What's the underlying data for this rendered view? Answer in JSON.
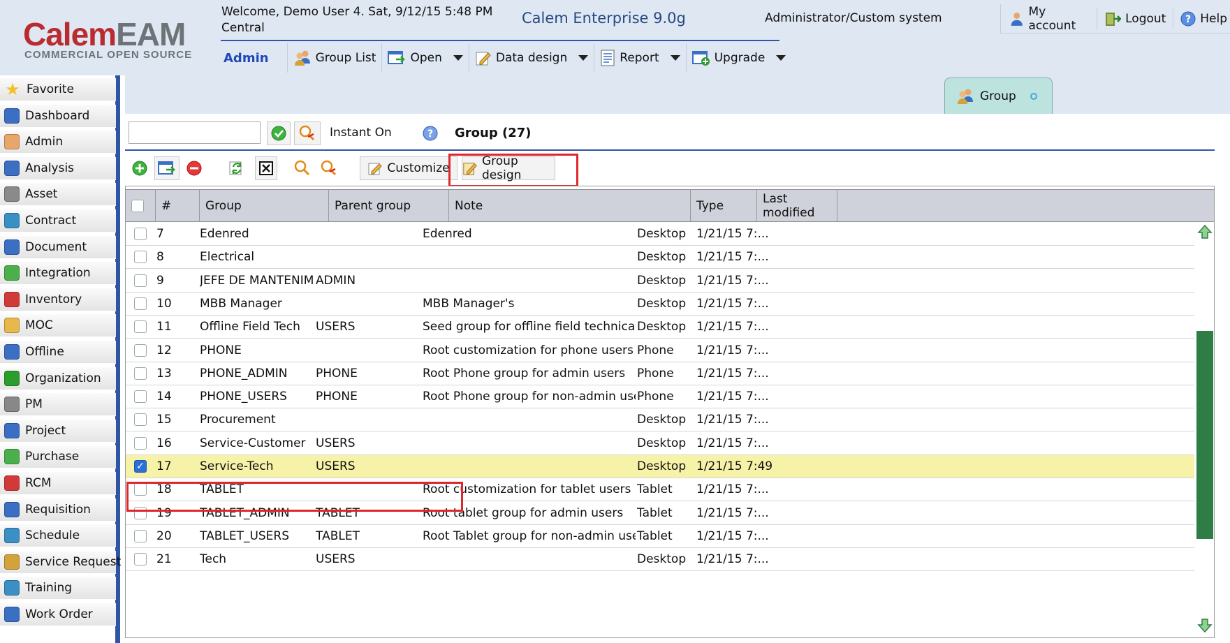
{
  "header": {
    "logo_main_1": "Calem",
    "logo_main_2": "EAM",
    "logo_sub": "COMMERCIAL OPEN SOURCE",
    "welcome_line1": "Welcome, Demo User 4. Sat, 9/12/15 5:48 PM",
    "welcome_line2": "Central",
    "product": "Calem Enterprise 9.0g",
    "admin_system": "Administrator/Custom system",
    "my_account": "My account",
    "logout": "Logout",
    "help": "Help"
  },
  "toolbar": {
    "section": "Admin",
    "group_list": "Group List",
    "open": "Open",
    "data_design": "Data design",
    "report": "Report",
    "upgrade": "Upgrade"
  },
  "sidebar": {
    "items": [
      {
        "label": "Favorite",
        "icon": "star-icon"
      },
      {
        "label": "Dashboard",
        "icon": "dashboard-icon"
      },
      {
        "label": "Admin",
        "icon": "admin-icon"
      },
      {
        "label": "Analysis",
        "icon": "analysis-icon"
      },
      {
        "label": "Asset",
        "icon": "asset-icon"
      },
      {
        "label": "Contract",
        "icon": "contract-icon"
      },
      {
        "label": "Document",
        "icon": "document-icon"
      },
      {
        "label": "Integration",
        "icon": "integration-icon"
      },
      {
        "label": "Inventory",
        "icon": "inventory-icon"
      },
      {
        "label": "MOC",
        "icon": "moc-icon"
      },
      {
        "label": "Offline",
        "icon": "offline-icon"
      },
      {
        "label": "Organization",
        "icon": "organization-icon"
      },
      {
        "label": "PM",
        "icon": "pm-icon"
      },
      {
        "label": "Project",
        "icon": "project-icon"
      },
      {
        "label": "Purchase",
        "icon": "purchase-icon"
      },
      {
        "label": "RCM",
        "icon": "rcm-icon"
      },
      {
        "label": "Requisition",
        "icon": "requisition-icon"
      },
      {
        "label": "Schedule",
        "icon": "schedule-icon"
      },
      {
        "label": "Service Request",
        "icon": "service-request-icon"
      },
      {
        "label": "Training",
        "icon": "training-icon"
      },
      {
        "label": "Work Order",
        "icon": "work-order-icon"
      }
    ]
  },
  "tab": {
    "label": "Group"
  },
  "search": {
    "value": "",
    "instant_on": "Instant On",
    "title": "Group (27)"
  },
  "actions": {
    "customize": "Customize",
    "group_design": "Group design"
  },
  "grid": {
    "columns": [
      "#",
      "Group",
      "Parent group",
      "Note",
      "Type",
      "Last modified"
    ],
    "columns_display": {
      "type_h": "Type",
      "last_h1": "Last",
      "last_h2": "modified"
    },
    "rows": [
      {
        "num": "7",
        "group": "Edenred",
        "parent": "",
        "note": "Edenred",
        "type": "Desktop",
        "modified": "1/21/15 7:...",
        "checked": false
      },
      {
        "num": "8",
        "group": "Electrical",
        "parent": "",
        "note": "",
        "type": "Desktop",
        "modified": "1/21/15 7:...",
        "checked": false
      },
      {
        "num": "9",
        "group": "JEFE DE MANTENIM...",
        "parent": "ADMIN",
        "note": "",
        "type": "Desktop",
        "modified": "1/21/15 7:...",
        "checked": false
      },
      {
        "num": "10",
        "group": "MBB Manager",
        "parent": "",
        "note": "MBB Manager's",
        "type": "Desktop",
        "modified": "1/21/15 7:...",
        "checked": false
      },
      {
        "num": "11",
        "group": "Offline Field Tech",
        "parent": "USERS",
        "note": "Seed group for offline field technicans",
        "type": "Desktop",
        "modified": "1/21/15 7:...",
        "checked": false
      },
      {
        "num": "12",
        "group": "PHONE",
        "parent": "",
        "note": "Root customization for phone users",
        "type": "Phone",
        "modified": "1/21/15 7:...",
        "checked": false
      },
      {
        "num": "13",
        "group": "PHONE_ADMIN",
        "parent": "PHONE",
        "note": "Root Phone group for admin users",
        "type": "Phone",
        "modified": "1/21/15 7:...",
        "checked": false
      },
      {
        "num": "14",
        "group": "PHONE_USERS",
        "parent": "PHONE",
        "note": "Root Phone group for non-admin users",
        "type": "Phone",
        "modified": "1/21/15 7:...",
        "checked": false
      },
      {
        "num": "15",
        "group": "Procurement",
        "parent": "",
        "note": "",
        "type": "Desktop",
        "modified": "1/21/15 7:...",
        "checked": false
      },
      {
        "num": "16",
        "group": "Service-Customer",
        "parent": "USERS",
        "note": "",
        "type": "Desktop",
        "modified": "1/21/15 7:...",
        "checked": false
      },
      {
        "num": "17",
        "group": "Service-Tech",
        "parent": "USERS",
        "note": "",
        "type": "Desktop",
        "modified": "1/21/15 7:49",
        "checked": true
      },
      {
        "num": "18",
        "group": "TABLET",
        "parent": "",
        "note": "Root customization for tablet users",
        "type": "Tablet",
        "modified": "1/21/15 7:...",
        "checked": false
      },
      {
        "num": "19",
        "group": "TABLET_ADMIN",
        "parent": "TABLET",
        "note": "Root tablet group for admin users",
        "type": "Tablet",
        "modified": "1/21/15 7:...",
        "checked": false
      },
      {
        "num": "20",
        "group": "TABLET_USERS",
        "parent": "TABLET",
        "note": "Root Tablet group for non-admin users",
        "type": "Tablet",
        "modified": "1/21/15 7:...",
        "checked": false
      },
      {
        "num": "21",
        "group": "Tech",
        "parent": "USERS",
        "note": "",
        "type": "Desktop",
        "modified": "1/21/15 7:...",
        "checked": false
      }
    ]
  },
  "colors": {
    "header_bg": "#dfe7f3",
    "accent_blue": "#2f55a7",
    "selected_row": "#f6f3a8",
    "highlight_box": "#e0262d",
    "scroll_thumb": "#2f7d46"
  }
}
